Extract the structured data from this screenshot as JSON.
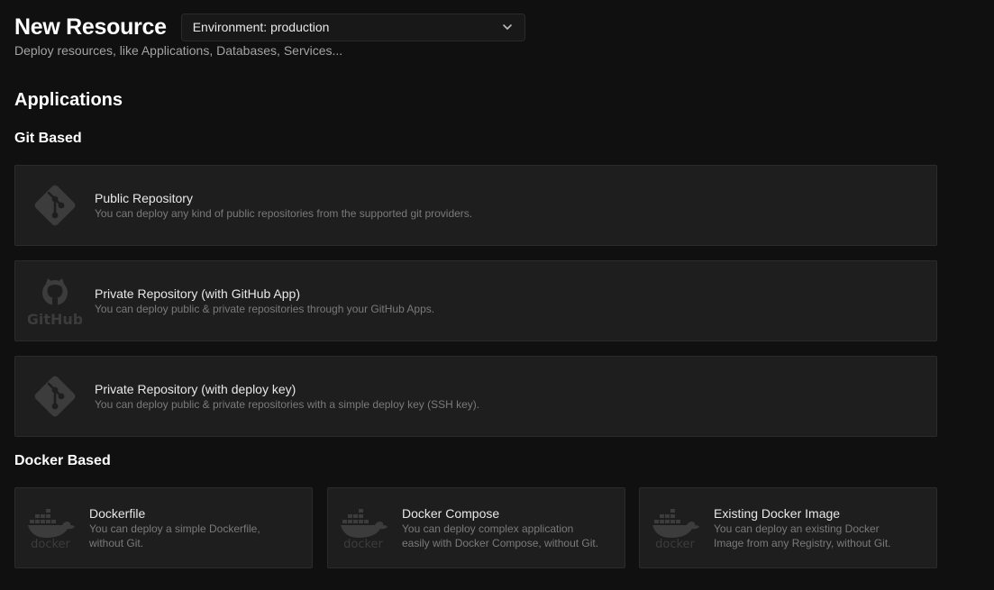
{
  "header": {
    "title": "New Resource",
    "environment_select": "Environment: production"
  },
  "subtitle": "Deploy resources, like Applications, Databases, Services...",
  "applications": {
    "title": "Applications",
    "git_based": {
      "title": "Git Based",
      "cards": [
        {
          "title": "Public Repository",
          "description": "You can deploy any kind of public repositories from the supported git providers.",
          "icon": "git-icon"
        },
        {
          "title": "Private Repository (with GitHub App)",
          "description": "You can deploy public & private repositories through your GitHub Apps.",
          "icon": "github-icon"
        },
        {
          "title": "Private Repository (with deploy key)",
          "description": "You can deploy public & private repositories with a simple deploy key (SSH key).",
          "icon": "git-icon"
        }
      ]
    },
    "docker_based": {
      "title": "Docker Based",
      "cards": [
        {
          "title": "Dockerfile",
          "description": "You can deploy a simple Dockerfile, without Git.",
          "icon": "docker-icon"
        },
        {
          "title": "Docker Compose",
          "description": "You can deploy complex application easily with Docker Compose, without Git.",
          "icon": "docker-icon"
        },
        {
          "title": "Existing Docker Image",
          "description": "You can deploy an existing Docker Image from any Registry, without Git.",
          "icon": "docker-icon"
        }
      ]
    }
  },
  "colors": {
    "background": "#101010",
    "card": "#1e1e1e",
    "card_border": "#2b2b2b",
    "logo_gray": "#3c3c3c",
    "muted_text": "#7a7a7a"
  }
}
